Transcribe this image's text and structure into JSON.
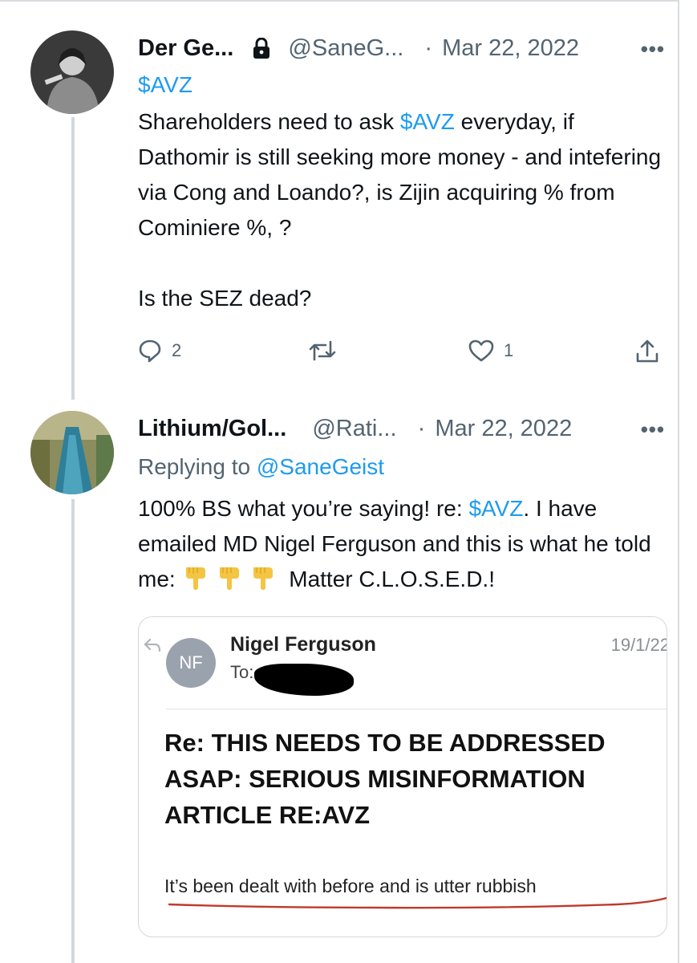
{
  "tweet1": {
    "author_name": "Der Ge...",
    "handle": "@SaneG...",
    "dot": "·",
    "date": "Mar 22, 2022",
    "more": "•••",
    "cashtag": "$AVZ",
    "body_pre": "Shareholders need to ask ",
    "body_link": "$AVZ",
    "body_post": " everyday, if Dathomir is still seeking more money - and intefering via Cong and Loando?, is Zijin acquiring % from Cominiere %, ?",
    "body_line2": "Is the SEZ dead?",
    "reply_count": "2",
    "retweet_count": "",
    "like_count": "1"
  },
  "tweet2": {
    "author_name": "Lithium/Gol...",
    "handle": "@Rati...",
    "dot": "·",
    "date": "Mar 22, 2022",
    "more": "•••",
    "replying_prefix": "Replying to ",
    "replying_handle": "@SaneGeist",
    "body_pre": "100% BS what you’re saying! re: ",
    "body_link": "$AVZ",
    "body_mid": ". I have emailed MD Nigel Ferguson and this is what he told me: ",
    "body_post": " Matter C.L.O.S.E.D.!",
    "emoji_name": "backhand-index-pointing-down-icon"
  },
  "email": {
    "avatar_initials": "NF",
    "sender": "Nigel Ferguson",
    "to_label": "To:",
    "date": "19/1/22",
    "subject": "Re: THIS NEEDS TO BE ADDRESSED\nASAP: SERIOUS MISINFORMATION\nARTICLE RE:AVZ",
    "body": "It’s been dealt with before and is utter rubbish"
  },
  "colors": {
    "link": "#1d9bf0",
    "muted": "#536471",
    "text": "#0f1419",
    "underline": "#c0392b",
    "emoji": "#f4c542"
  }
}
